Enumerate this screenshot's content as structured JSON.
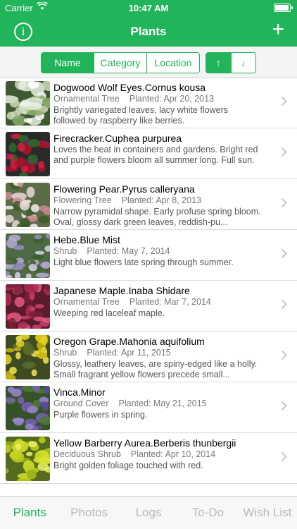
{
  "status": {
    "carrier": "Carrier",
    "time": "10:47 AM",
    "battery": 0.95
  },
  "nav": {
    "title": "Plants",
    "info_icon": "i",
    "add_icon": "+"
  },
  "sort": {
    "options": [
      "Name",
      "Category",
      "Location"
    ],
    "active": "Name",
    "ascending_icon": "↑",
    "descending_icon": "↓",
    "accent": "#22b45a"
  },
  "plants": [
    {
      "name": "Dogwood Wolf Eyes.Cornus kousa",
      "category": "Ornamental Tree",
      "planted": "Planted: Apr 20, 2013",
      "description": "Brightly variegated leaves, lacy white flowers followed by raspberry like berries."
    },
    {
      "name": "Firecracker.Cuphea purpurea",
      "category": "",
      "planted": "",
      "description": "Loves the heat in containers and gardens. Bright red and purple flowers bloom all summer long. Full sun."
    },
    {
      "name": "Flowering Pear.Pyrus calleryana",
      "category": "Flowering Tree",
      "planted": "Planted: Apr 8, 2013",
      "description": "Narrow pyramidal shape. Early profuse spring bloom. Oval, glossy dark green leaves, reddish-pu..."
    },
    {
      "name": "Hebe.Blue Mist",
      "category": "Shrub",
      "planted": "Planted: May 7, 2014",
      "description": "Light blue flowers late spring through summer."
    },
    {
      "name": "Japanese Maple.Inaba Shidare",
      "category": "Ornamental Tree",
      "planted": "Planted: Mar 7, 2014",
      "description": "Weeping red laceleaf maple."
    },
    {
      "name": "Oregon Grape.Mahonia aquifolium",
      "category": "Shrub",
      "planted": "Planted: Apr 11, 2015",
      "description": "Glossy, leathery leaves, are spiny-edged like a holly. Small fragrant yellow flowers precede small..."
    },
    {
      "name": "Vinca.Minor",
      "category": "Ground Cover",
      "planted": "Planted: May 21, 2015",
      "description": "Purple flowers in spring."
    },
    {
      "name": "Yellow Barberry Aurea.Berberis thunbergii",
      "category": "Deciduous Shrub",
      "planted": "Planted: Apr 10, 2014",
      "description": "Bright golden foliage touched with red."
    }
  ],
  "tabs": [
    "Plants",
    "Photos",
    "Logs",
    "To-Do",
    "Wish List"
  ],
  "active_tab": "Plants"
}
